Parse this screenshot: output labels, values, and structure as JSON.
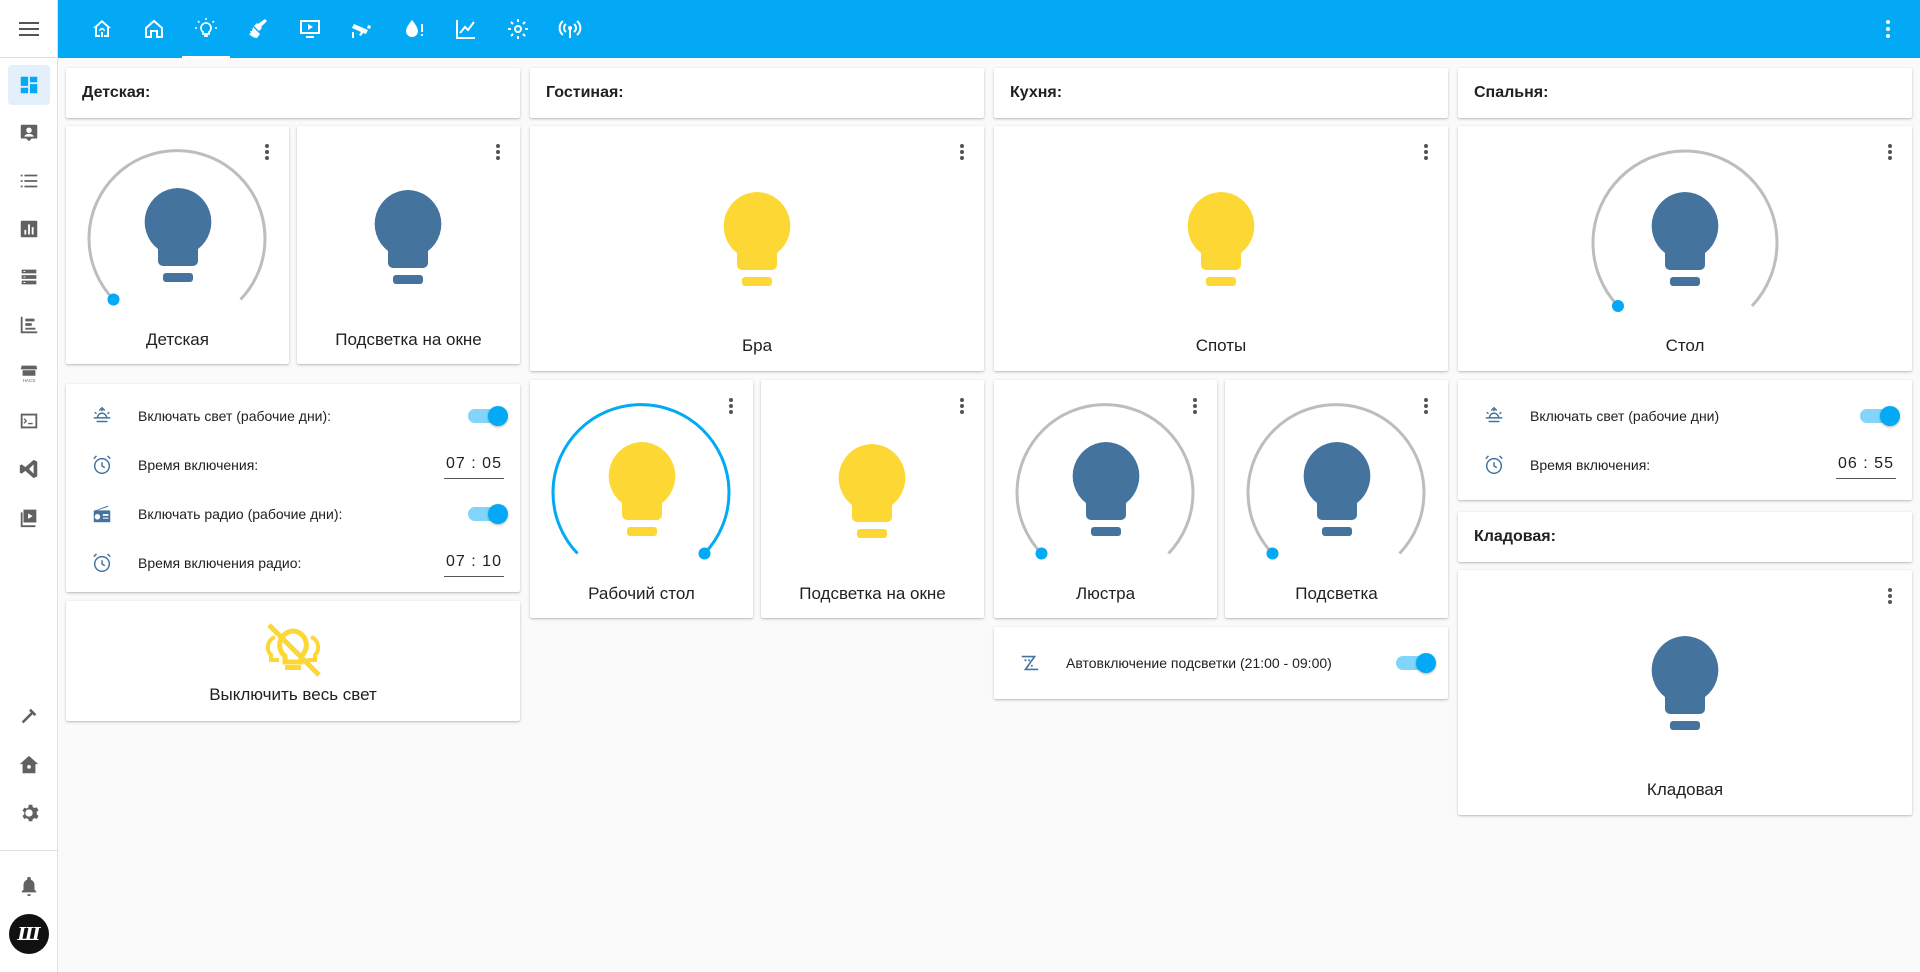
{
  "colors": {
    "accent": "#03a9f4",
    "bulb_on": "#fdd835",
    "bulb_off": "#44739e",
    "dial_track": "#bdbdbd"
  },
  "sidebar": {
    "menu_icon": "hamburger-icon",
    "items": [
      {
        "icon": "dashboard-icon",
        "active": true
      },
      {
        "icon": "account-box-icon"
      },
      {
        "icon": "list-icon"
      },
      {
        "icon": "chart-box-icon"
      },
      {
        "icon": "server-icon"
      },
      {
        "icon": "chart-timeline-icon"
      },
      {
        "icon": "hacs-icon"
      },
      {
        "icon": "console-icon"
      },
      {
        "icon": "vscode-icon"
      },
      {
        "icon": "play-box-icon"
      },
      {
        "icon": "hammer-icon"
      },
      {
        "icon": "home-assistant-icon"
      },
      {
        "icon": "cog-icon"
      },
      {
        "icon": "bell-icon"
      }
    ],
    "avatar_text": "Ш"
  },
  "header": {
    "tabs": [
      "home-automation-icon",
      "home-icon",
      "lightbulb-icon",
      "broom-icon",
      "monitor-play-icon",
      "cctv-icon",
      "water-alert-icon",
      "chart-line-icon",
      "cog-icon",
      "access-point-icon"
    ],
    "active_tab": 2,
    "more_icon": "dots-vertical-icon"
  },
  "col1": {
    "title": "Детская:",
    "light1": {
      "name": "Детская",
      "state": "off"
    },
    "light2": {
      "name": "Подсветка на окне",
      "state": "off"
    },
    "rows": [
      {
        "icon": "sun-clock-icon",
        "label": "Включать свет (рабочие дни):",
        "type": "toggle"
      },
      {
        "icon": "alarm-icon",
        "label": "Время включения:",
        "type": "time",
        "value": "07 : 05"
      },
      {
        "icon": "radio-icon",
        "label": "Включать радио (рабочие дни):",
        "type": "toggle"
      },
      {
        "icon": "alarm-icon",
        "label": "Время включения радио:",
        "type": "time",
        "value": "07 : 10"
      }
    ],
    "script": {
      "icon": "lightbulb-group-off-icon",
      "name": "Выключить весь свет"
    }
  },
  "col2": {
    "title": "Гостиная:",
    "light_main": {
      "name": "Бра",
      "state": "on"
    },
    "light1": {
      "name": "Рабочий стол",
      "state": "on"
    },
    "light2": {
      "name": "Подсветка на окне",
      "state": "on"
    }
  },
  "col3": {
    "title": "Кухня:",
    "light_main": {
      "name": "Споты",
      "state": "on"
    },
    "light1": {
      "name": "Люстра",
      "state": "off"
    },
    "light2": {
      "name": "Подсветка",
      "state": "off"
    },
    "row": {
      "icon": "led-strip-icon",
      "label": "Автовключение подсветки (21:00 - 09:00)",
      "type": "toggle"
    }
  },
  "col4": {
    "title": "Спальня:",
    "light_main": {
      "name": "Стол",
      "state": "off"
    },
    "rows": [
      {
        "icon": "sun-clock-icon",
        "label": "Включать свет (рабочие дни)",
        "type": "toggle"
      },
      {
        "icon": "alarm-icon",
        "label": "Время включения:",
        "type": "time",
        "value": "06 : 55"
      }
    ],
    "title2": "Кладовая:",
    "light_storage": {
      "name": "Кладовая",
      "state": "off"
    }
  }
}
